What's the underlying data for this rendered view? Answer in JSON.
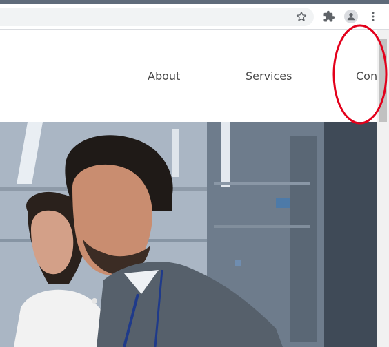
{
  "browser": {
    "icons": [
      "star-icon",
      "extensions-puzzle-icon",
      "profile-avatar-icon",
      "menu-kebab-icon"
    ]
  },
  "nav": {
    "about": "About",
    "services": "Services",
    "contact_partial": "Con"
  },
  "colors": {
    "annotation_circle": "#e3001b",
    "nav_text": "#4a4a4a"
  }
}
